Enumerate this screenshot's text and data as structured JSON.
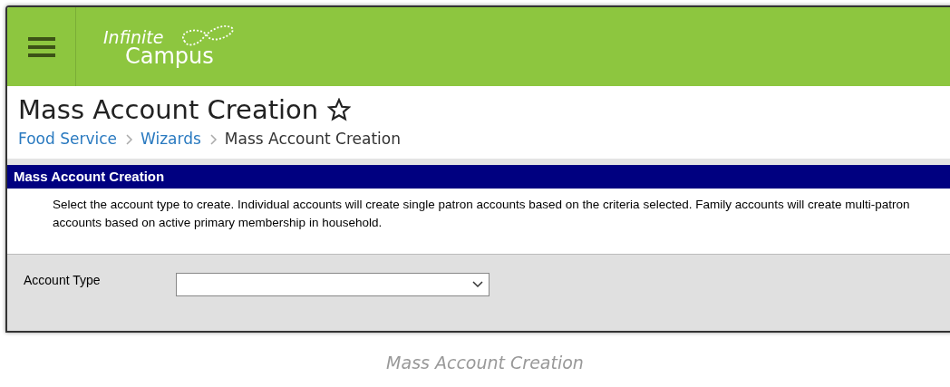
{
  "header": {
    "logo": {
      "line1": "Infinite",
      "line2": "Campus"
    }
  },
  "page": {
    "title": "Mass Account Creation",
    "favorite": false
  },
  "breadcrumb": [
    {
      "label": "Food Service",
      "link": true
    },
    {
      "label": "Wizards",
      "link": true
    },
    {
      "label": "Mass Account Creation",
      "link": false
    }
  ],
  "panel": {
    "title": "Mass Account Creation",
    "description": "Select the account type to create. Individual accounts will create single patron accounts based on the criteria selected. Family accounts will create multi-patron accounts based on active primary membership in household."
  },
  "form": {
    "fields": [
      {
        "label": "Account Type",
        "kind": "select"
      }
    ]
  },
  "caption": "Mass Account Creation"
}
